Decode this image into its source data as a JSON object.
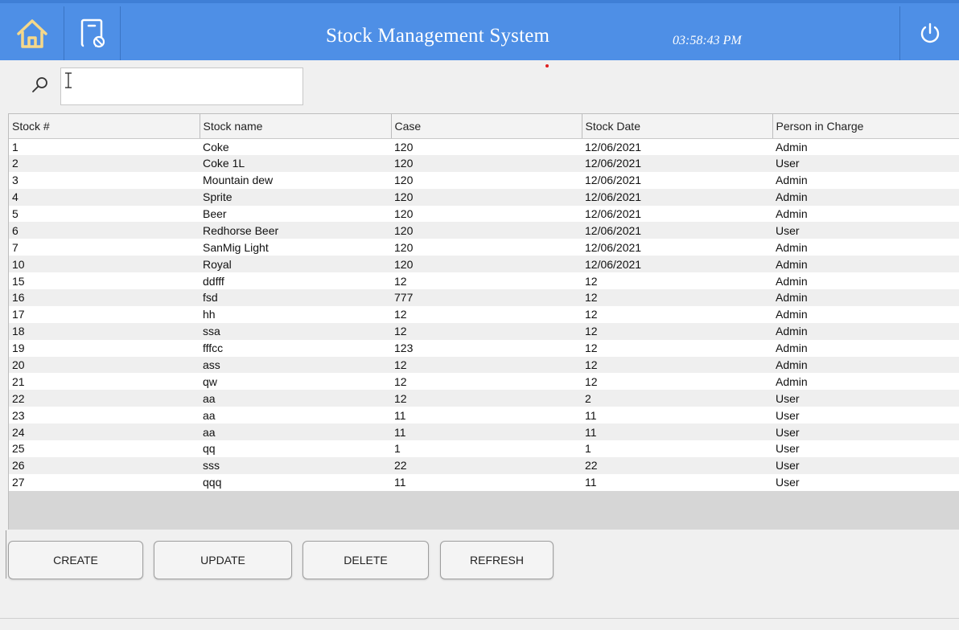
{
  "header": {
    "title": "Stock Management System",
    "time": "03:58:43 PM",
    "icons": {
      "home": "home-icon",
      "device": "device-icon",
      "power": "power-icon"
    }
  },
  "search": {
    "value": "",
    "placeholder": ""
  },
  "table": {
    "columns": [
      "Stock #",
      "Stock name",
      "Case",
      "Stock Date",
      "Person in Charge"
    ],
    "rows": [
      [
        "1",
        "Coke",
        "120",
        "12/06/2021",
        "Admin"
      ],
      [
        "2",
        "Coke 1L",
        "120",
        "12/06/2021",
        "User"
      ],
      [
        "3",
        "Mountain dew",
        "120",
        "12/06/2021",
        "Admin"
      ],
      [
        "4",
        "Sprite",
        "120",
        "12/06/2021",
        "Admin"
      ],
      [
        "5",
        "Beer",
        "120",
        "12/06/2021",
        "Admin"
      ],
      [
        "6",
        "Redhorse Beer",
        "120",
        "12/06/2021",
        "User"
      ],
      [
        "7",
        "SanMig Light",
        "120",
        "12/06/2021",
        "Admin"
      ],
      [
        "10",
        "Royal",
        "120",
        "12/06/2021",
        "Admin"
      ],
      [
        "15",
        "ddfff",
        "12",
        "12",
        "Admin"
      ],
      [
        "16",
        "fsd",
        "777",
        "12",
        "Admin"
      ],
      [
        "17",
        "hh",
        "12",
        "12",
        "Admin"
      ],
      [
        "18",
        "ssa",
        "12",
        "12",
        "Admin"
      ],
      [
        "19",
        "fffcc",
        "123",
        "12",
        "Admin"
      ],
      [
        "20",
        "ass",
        "12",
        "12",
        "Admin"
      ],
      [
        "21",
        "qw",
        "12",
        "12",
        "Admin"
      ],
      [
        "22",
        "aa",
        "12",
        "2",
        "User"
      ],
      [
        "23",
        "aa",
        "11",
        "11",
        "User"
      ],
      [
        "24",
        "aa",
        "11",
        "11",
        "User"
      ],
      [
        "25",
        "qq",
        "1",
        "1",
        "User"
      ],
      [
        "26",
        "sss",
        "22",
        "22",
        "User"
      ],
      [
        "27",
        "qqq",
        "11",
        "11",
        "User"
      ]
    ]
  },
  "buttons": {
    "create": "CREATE",
    "update": "UPDATE",
    "delete": "DELETE",
    "refresh": "REFRESH"
  },
  "colors": {
    "header": "#4e8fe6",
    "home_icon": "#f5d88a"
  }
}
